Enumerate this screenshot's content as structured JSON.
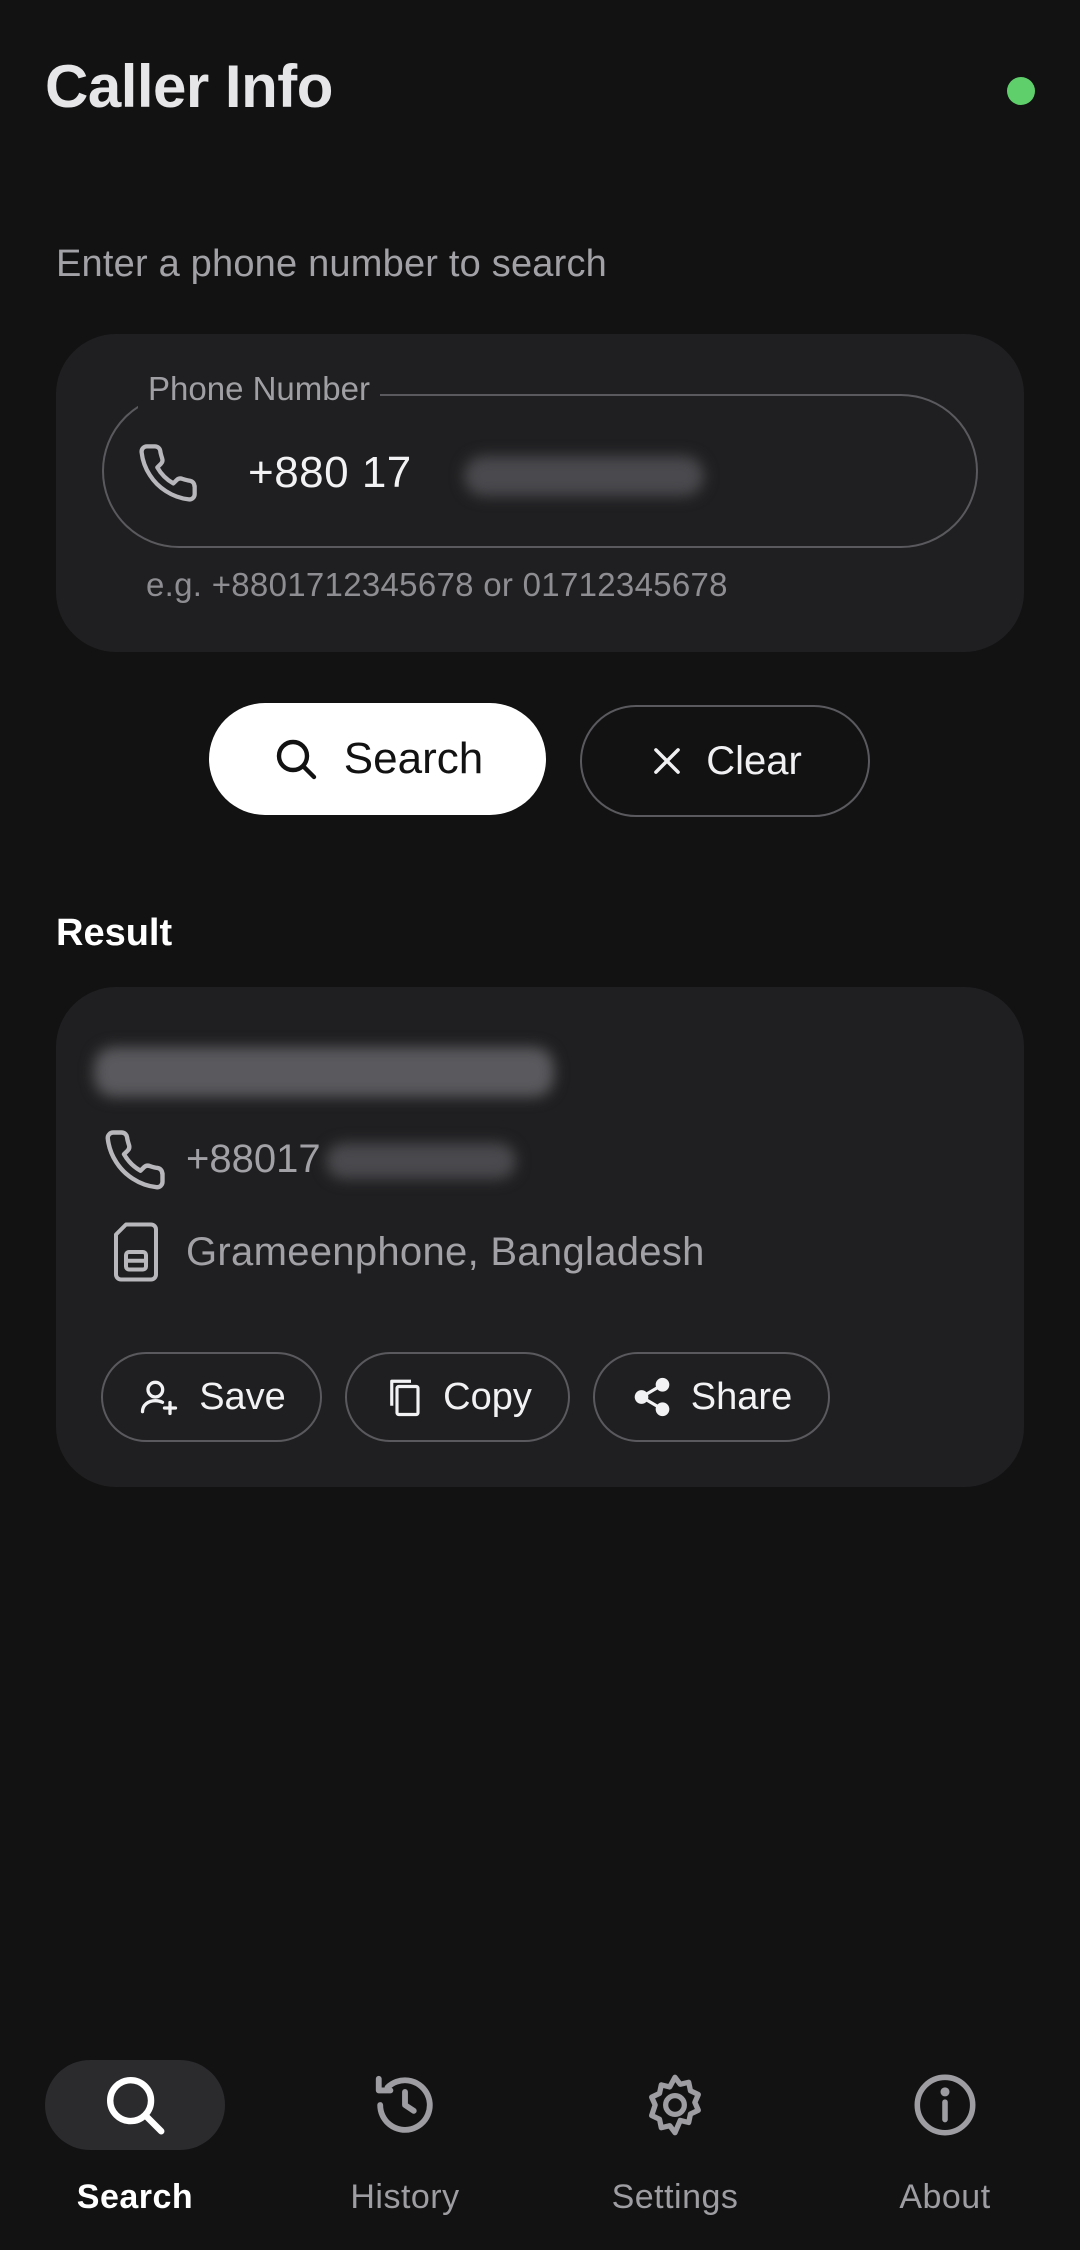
{
  "header": {
    "title": "Caller Info",
    "status_color": "#5fcf6b"
  },
  "search": {
    "prompt": "Enter a phone number to search",
    "field_label": "Phone Number",
    "field_value": "+880 17",
    "helper": "e.g. +8801712345678 or 01712345678",
    "field_icon": "phone-icon",
    "search_label": "Search",
    "search_icon": "search-icon",
    "clear_label": "Clear",
    "clear_icon": "close-icon"
  },
  "result": {
    "section_title": "Result",
    "phone": "+88017",
    "carrier": "Grameenphone, Bangladesh",
    "phone_icon": "phone-icon",
    "carrier_icon": "sim-card-icon",
    "actions": [
      {
        "label": "Save",
        "icon": "add-person-icon"
      },
      {
        "label": "Copy",
        "icon": "copy-icon"
      },
      {
        "label": "Share",
        "icon": "share-icon"
      }
    ]
  },
  "nav": {
    "active": "Search",
    "items": [
      {
        "label": "Search",
        "icon": "search-icon"
      },
      {
        "label": "History",
        "icon": "history-icon"
      },
      {
        "label": "Settings",
        "icon": "gear-icon"
      },
      {
        "label": "About",
        "icon": "info-icon"
      }
    ]
  }
}
